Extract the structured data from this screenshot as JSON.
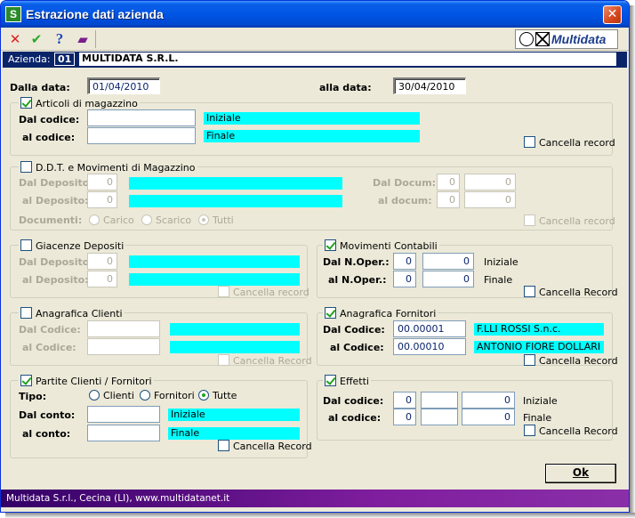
{
  "window": {
    "title": "Estrazione dati azienda",
    "close": "✕",
    "app_icon": "S"
  },
  "toolbar": {
    "icons": [
      "cancel-x-icon",
      "confirm-check-icon",
      "help-question-icon",
      "manual-book-icon"
    ],
    "cancel": "✕",
    "ok": "✔",
    "help": "?",
    "book": "▰"
  },
  "logo": {
    "text": "Multidata"
  },
  "company": {
    "label": "Azienda:",
    "code": "01",
    "name": "MULTIDATA S.R.L."
  },
  "dates": {
    "from_label": "Dalla data:",
    "from_value": "01/04/2010",
    "to_label": "alla data:",
    "to_value": "30/04/2010"
  },
  "articoli": {
    "title": "Articoli di magazzino",
    "checked": true,
    "from_label": "Dal codice:",
    "to_label": "al codice:",
    "from_value": "",
    "to_value": "",
    "from_desc": "Iniziale",
    "to_desc": "Finale",
    "delete_label": "Cancella record"
  },
  "ddt": {
    "title": "D.D.T. e Movimenti di Magazzino",
    "checked": false,
    "dep_from_label": "Dal Deposito:",
    "dep_to_label": "al Deposito:",
    "dep_from": "0",
    "dep_to": "0",
    "doc_from_label": "Dal Docum:",
    "doc_to_label": "al docum:",
    "doc_from_a": "0",
    "doc_from_b": "0",
    "doc_to_a": "0",
    "doc_to_b": "0",
    "docs_label": "Documenti:",
    "opt_carico": "Carico",
    "opt_scarico": "Scarico",
    "opt_tutti": "Tutti",
    "delete_label": "Cancella record"
  },
  "giacenze": {
    "title": "Giacenze Depositi",
    "checked": false,
    "from_label": "Dal Deposito:",
    "to_label": "al Deposito:",
    "from_value": "0",
    "to_value": "0",
    "delete_label": "Cancella record"
  },
  "movimenti": {
    "title": "Movimenti Contabili",
    "checked": true,
    "from_label": "Dal N.Oper.:",
    "to_label": "al N.Oper.:",
    "from_a": "0",
    "from_b": "0",
    "to_a": "0",
    "to_b": "0",
    "from_desc": "Iniziale",
    "to_desc": "Finale",
    "delete_label": "Cancella Record"
  },
  "clienti": {
    "title": "Anagrafica Clienti",
    "checked": false,
    "from_label": "Dal Codice:",
    "to_label": "al Codice:",
    "from_value": "",
    "to_value": "",
    "delete_label": "Cancella Record"
  },
  "fornitori": {
    "title": "Anagrafica Fornitori",
    "checked": true,
    "from_label": "Dal Codice:",
    "to_label": "al Codice:",
    "from_value": "00.00001",
    "to_value": "00.00010",
    "from_desc": "F.LLI ROSSI S.n.c.",
    "to_desc": "ANTONIO FIORE DOLLARI",
    "delete_label": "Cancella Record"
  },
  "partite": {
    "title": "Partite Clienti / Fornitori",
    "checked": true,
    "type_label": "Tipo:",
    "opt_clienti": "Clienti",
    "opt_fornitori": "Fornitori",
    "opt_tutte": "Tutte",
    "from_label": "Dal conto:",
    "to_label": "al conto:",
    "from_value": "",
    "to_value": "",
    "from_desc": "Iniziale",
    "to_desc": "Finale",
    "delete_label": "Cancella Record"
  },
  "effetti": {
    "title": "Effetti",
    "checked": true,
    "from_label": "Dal codice:",
    "to_label": "al codice:",
    "from_a": "0",
    "from_b": "",
    "from_c": "0",
    "to_a": "0",
    "to_b": "",
    "to_c": "0",
    "from_desc": "Iniziale",
    "to_desc": "Finale",
    "delete_label": "Cancella Record"
  },
  "ok_button": {
    "label": "Ok"
  },
  "status": {
    "text": "Multidata S.r.l., Cecina (LI), www.multidatanet.it"
  }
}
